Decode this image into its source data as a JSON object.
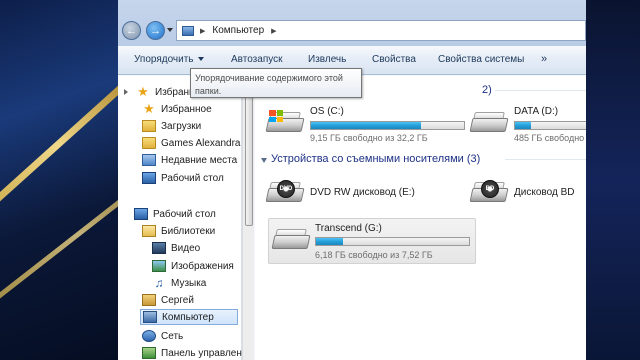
{
  "window": {
    "address": {
      "path": "Компьютер"
    }
  },
  "toolbar": {
    "organize": "Упорядочить",
    "autorun": "Автозапуск",
    "eject": "Извлечь",
    "properties": "Свойства",
    "system_properties": "Свойства системы",
    "more": "»"
  },
  "tooltip": {
    "text": "Упорядочивание содержимого этой папки."
  },
  "sidebar": {
    "items": [
      {
        "label": "Избранное",
        "icon": "star-icon"
      },
      {
        "label": "Избранное",
        "icon": "star-icon"
      },
      {
        "label": "Загрузки",
        "icon": "downloads-folder-icon"
      },
      {
        "label": "Games Alexandra",
        "icon": "folder-icon"
      },
      {
        "label": "Недавние места",
        "icon": "recent-places-icon"
      },
      {
        "label": "Рабочий стол",
        "icon": "desktop-icon"
      },
      {
        "label": "Рабочий стол",
        "icon": "desktop-icon"
      },
      {
        "label": "Библиотеки",
        "icon": "libraries-icon"
      },
      {
        "label": "Видео",
        "icon": "video-library-icon"
      },
      {
        "label": "Изображения",
        "icon": "images-library-icon"
      },
      {
        "label": "Музыка",
        "icon": "music-library-icon"
      },
      {
        "label": "Сергей",
        "icon": "user-folder-icon"
      },
      {
        "label": "Компьютер",
        "icon": "computer-icon"
      },
      {
        "label": "Сеть",
        "icon": "network-icon"
      },
      {
        "label": "Панель управлен",
        "icon": "control-panel-icon"
      }
    ]
  },
  "content": {
    "hdd_group": {
      "count_suffix": "2)"
    },
    "removable_group": {
      "title": "Устройства со съемными носителями (3)"
    },
    "drives": {
      "c": {
        "name": "OS (C:)",
        "free": "9,15 ГБ свободно из 32,2 ГБ",
        "used_fraction": 0.716
      },
      "d": {
        "name": "DATA (D:)",
        "free": "485 ГБ свободно",
        "used_fraction": 0.2
      },
      "e": {
        "name": "DVD RW дисковод (E:)",
        "badge": "DVD"
      },
      "f": {
        "name": "Дисковод BD",
        "badge": "BD"
      },
      "g": {
        "name": "Transcend (G:)",
        "free": "6,18 ГБ свободно из 7,52 ГБ",
        "used_fraction": 0.178
      }
    }
  },
  "colors": {
    "accent": "#26a0da",
    "group_header": "#1e3287",
    "toolbar_text": "#1e395b"
  }
}
